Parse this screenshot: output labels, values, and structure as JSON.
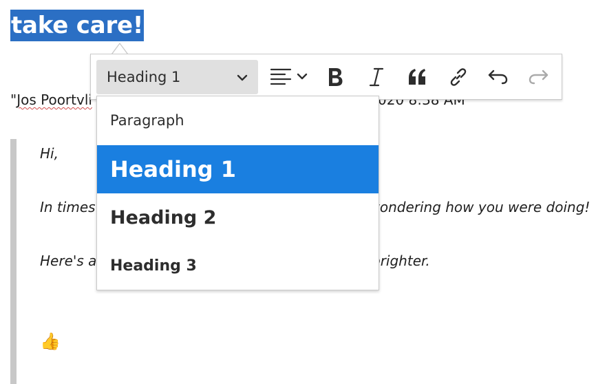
{
  "document": {
    "heading": "take care!",
    "from_prefix": "\"",
    "from_name": "Jos Poortvli",
    "from_tail": "020 8:38 AM",
    "quote_lines": [
      {
        "left": "Hi,",
        "right": ""
      },
      {
        "left": "In times",
        "right": "vondering how you were doing!"
      },
      {
        "left": "Here's a",
        "right": "brighter."
      }
    ],
    "thumb_emoji": "👍"
  },
  "toolbar": {
    "block_format_value": "Heading 1",
    "icons": [
      "align-left-icon",
      "bold-icon",
      "italic-icon",
      "quote-icon",
      "link-icon",
      "undo-icon",
      "redo-icon"
    ]
  },
  "dropdown": {
    "options": [
      "Paragraph",
      "Heading 1",
      "Heading 2",
      "Heading 3"
    ],
    "selected": "Heading 1"
  },
  "colors": {
    "selection": "#2b6fc4",
    "dropdown_highlight": "#1a7fe0",
    "select_bg": "#e0e0e0",
    "quote_bar": "#c8c8c8",
    "spellcheck": "#d04a4a",
    "disabled_icon": "#aaaaaa"
  }
}
